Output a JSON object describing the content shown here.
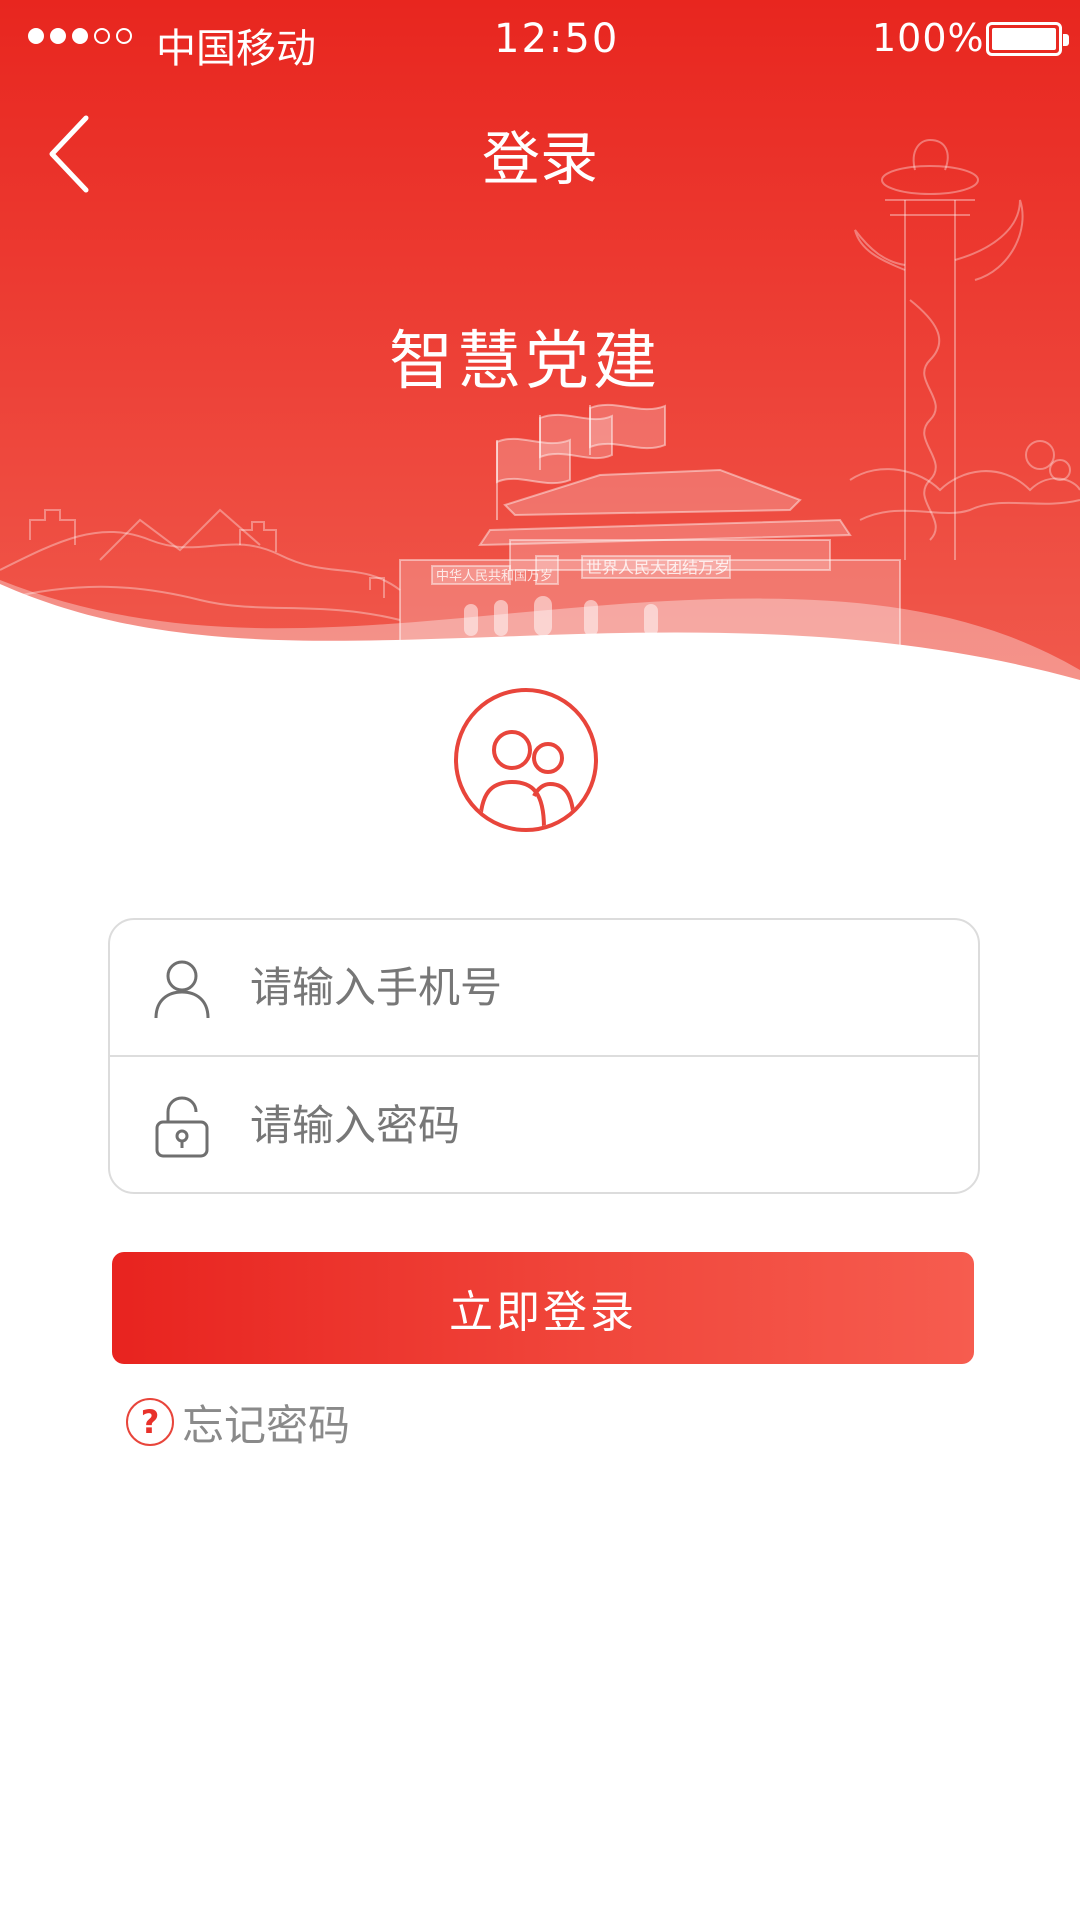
{
  "status_bar": {
    "carrier": "中国移动",
    "time": "12:50",
    "battery": "100%",
    "signal_bars_filled": 3,
    "signal_bars_total": 5
  },
  "nav": {
    "title": "登录",
    "back_icon": "chevron-left-icon"
  },
  "hero": {
    "app_name": "智慧党建",
    "banner_left": "中华人民共和国万岁",
    "banner_right": "世界人民大团结万岁"
  },
  "avatar": {
    "icon": "users-group-icon"
  },
  "form": {
    "phone": {
      "placeholder": "请输入手机号",
      "value": "",
      "icon": "user-icon"
    },
    "password": {
      "placeholder": "请输入密码",
      "value": "",
      "icon": "lock-icon"
    }
  },
  "login_button": {
    "label": "立即登录"
  },
  "forgot": {
    "label": "忘记密码",
    "icon": "question-circle-icon"
  },
  "colors": {
    "primary": "#e8261f",
    "primary_light": "#f65c4f",
    "border": "#dcdcdc",
    "placeholder": "#777777"
  }
}
